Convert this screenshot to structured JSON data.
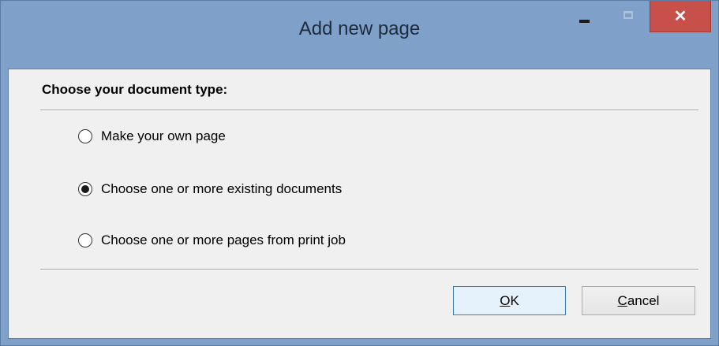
{
  "window": {
    "title": "Add new page",
    "close_glyph": "✕"
  },
  "dialog": {
    "heading": "Choose your document type:",
    "options": [
      {
        "label": "Make your own page",
        "selected": false
      },
      {
        "label": "Choose one or more existing documents",
        "selected": true
      },
      {
        "label": "Choose one or more pages from print job",
        "selected": false
      }
    ],
    "ok": {
      "mnemonic": "O",
      "rest": "K"
    },
    "cancel": {
      "mnemonic": "C",
      "rest": "ancel"
    }
  },
  "icons": {
    "minimize": "minimize-icon",
    "maximize": "maximize-icon",
    "close": "close-icon"
  },
  "colors": {
    "title_bar": "#7fa0c8",
    "close_button": "#c7504a",
    "client_bg": "#f0f0f0",
    "default_button_border": "#3c7fb1"
  }
}
